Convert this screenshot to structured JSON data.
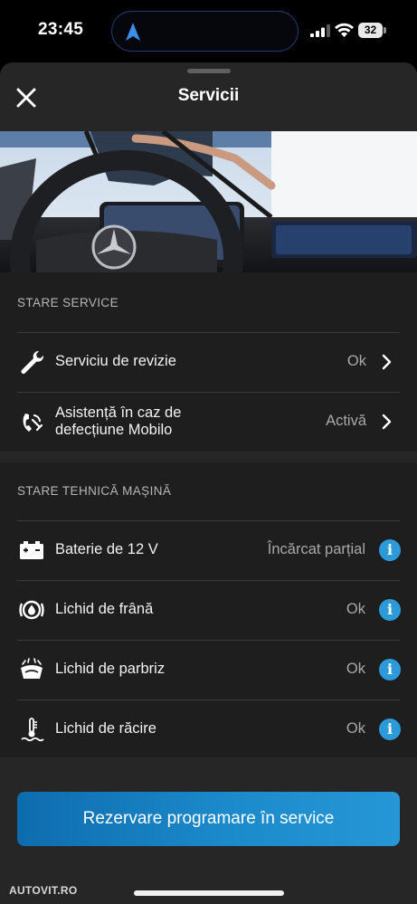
{
  "status_bar": {
    "time": "23:45",
    "battery_level": "32"
  },
  "header": {
    "title": "Servicii",
    "close_icon": "close-icon"
  },
  "sections": {
    "service": {
      "header": "STARE SERVICE",
      "rows": [
        {
          "label": "Serviciu de revizie",
          "value": "Ok",
          "icon": "wrench-icon",
          "action": "chevron-right-icon"
        },
        {
          "label": "Asistență în caz de defecțiune Mobilo",
          "value": "Activă",
          "icon": "roadside-assistance-icon",
          "action": "chevron-right-icon"
        }
      ]
    },
    "technical": {
      "header": "STARE TEHNICĂ MAȘINĂ",
      "rows": [
        {
          "label": "Baterie de 12 V",
          "value": "Încărcat parțial",
          "icon": "battery-icon",
          "action": "info-icon"
        },
        {
          "label": "Lichid de frână",
          "value": "Ok",
          "icon": "brake-fluid-icon",
          "action": "info-icon"
        },
        {
          "label": "Lichid de parbriz",
          "value": "Ok",
          "icon": "washer-fluid-icon",
          "action": "info-icon"
        },
        {
          "label": "Lichid de răcire",
          "value": "Ok",
          "icon": "coolant-icon",
          "action": "info-icon"
        }
      ]
    }
  },
  "primary_button": {
    "label": "Rezervare programare în service"
  },
  "watermark": "AUTOVIT.RO",
  "colors": {
    "accent": "#1b8acb",
    "info": "#2c9ad8",
    "background": "#262626",
    "section": "#1e1e1e"
  }
}
